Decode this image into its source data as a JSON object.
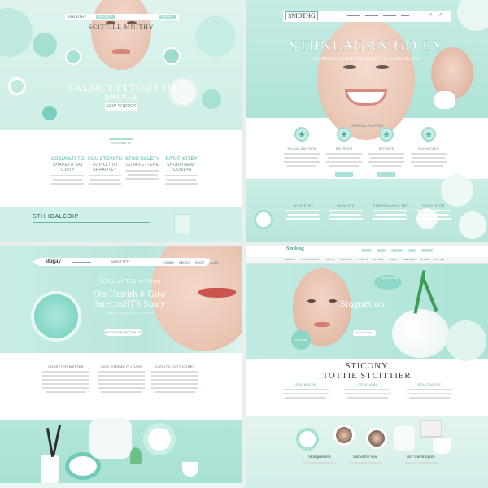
{
  "q1": {
    "nav": {
      "logo": "SMOOTHY",
      "link_active": "SPOTITY",
      "link_other": "SPORT"
    },
    "hero": {
      "subtitle": "SCITTILE MNITHY",
      "title_line1": "BALNCYTTTOUTTO",
      "title_line2": "SROCA",
      "button": "NEW SORRES"
    },
    "section": {
      "badge": "STITCAULTY",
      "columns": [
        {
          "title": "COSMULTI TO",
          "caption": "SHAPETO SKI TOUTY"
        },
        {
          "title": "SOU STEPSTN",
          "caption": "SOPIOD TO SPRAOTEY"
        },
        {
          "title": "STOO NCLETY",
          "caption": "COMPLETTENE"
        },
        {
          "title": "RATATHOTEY",
          "caption": "SHORIYNENT TOUMENT"
        }
      ]
    },
    "footer": {
      "title": "STHHOALCOIP"
    }
  },
  "q2": {
    "nav": {
      "logo": "SMOTHG"
    },
    "hero": {
      "title": "STHNLAGAN GO EY",
      "subtitle": "BOHCHOLD BEATE CONCTIVELTE SKOW"
    },
    "features": {
      "label": "SPOHCIAL PLACTRD",
      "items": [
        "SKINCLAMTOCN",
        "ENTIROR",
        "STIPHTE",
        "SUNINCLES"
      ]
    },
    "band": {
      "items": [
        "SKINTEERY",
        "SKINLOTE",
        "STUPSOCLAGE TEE",
        "SONGTEOTE"
      ]
    }
  },
  "q3": {
    "nav": {
      "logo": "stogay",
      "link_active": "SOKOTTFTY",
      "links": [
        "HOME",
        "ABOUT",
        "SHOP",
        "BLOG",
        "CONTACT"
      ]
    },
    "hero": {
      "eyebrow": "BEAOLLY TECHIITIANO",
      "title_line1": "Ots Hctrirh ¢ Gtro",
      "title_line2": "SsreconSTS Soaty",
      "subtitle": "TSMOTROTHLCOA N STAR",
      "button": "MOOLOCE MOTVALS"
    },
    "columns": [
      "SONSTTER MATTER",
      "COSI STREAE PLITURE",
      "COSOTS COTT CORET"
    ]
  },
  "q4": {
    "nav": {
      "logo": "Sinthing",
      "menu": [
        "SIBLOTH",
        "STOSSTTLOCTY",
        "STOTH",
        "STOSITIOT",
        "STOLTS",
        "STTCRG",
        "SCHOT",
        "SHSTOTE",
        "STOSE",
        "STOTHE"
      ],
      "top_links": [
        "SHOP",
        "BLOG",
        "SOCIAL",
        "SPA",
        "TOUCH"
      ]
    },
    "hero": {
      "tag": "SETTARTOSE",
      "title": "Stognetion",
      "button": "SHOP NOW",
      "badge": "SKIN CARE"
    },
    "section": {
      "title_line1": "STICONY",
      "title_line2": "TOTTIE STCITTIER",
      "columns": [
        "STIOM STIE",
        "STRATIOSE",
        "STALTSHOTE"
      ]
    },
    "footer": {
      "items": [
        "Stomprebutos",
        "Sas Stitrie Stee",
        "sitt The Stingiste"
      ]
    }
  }
}
